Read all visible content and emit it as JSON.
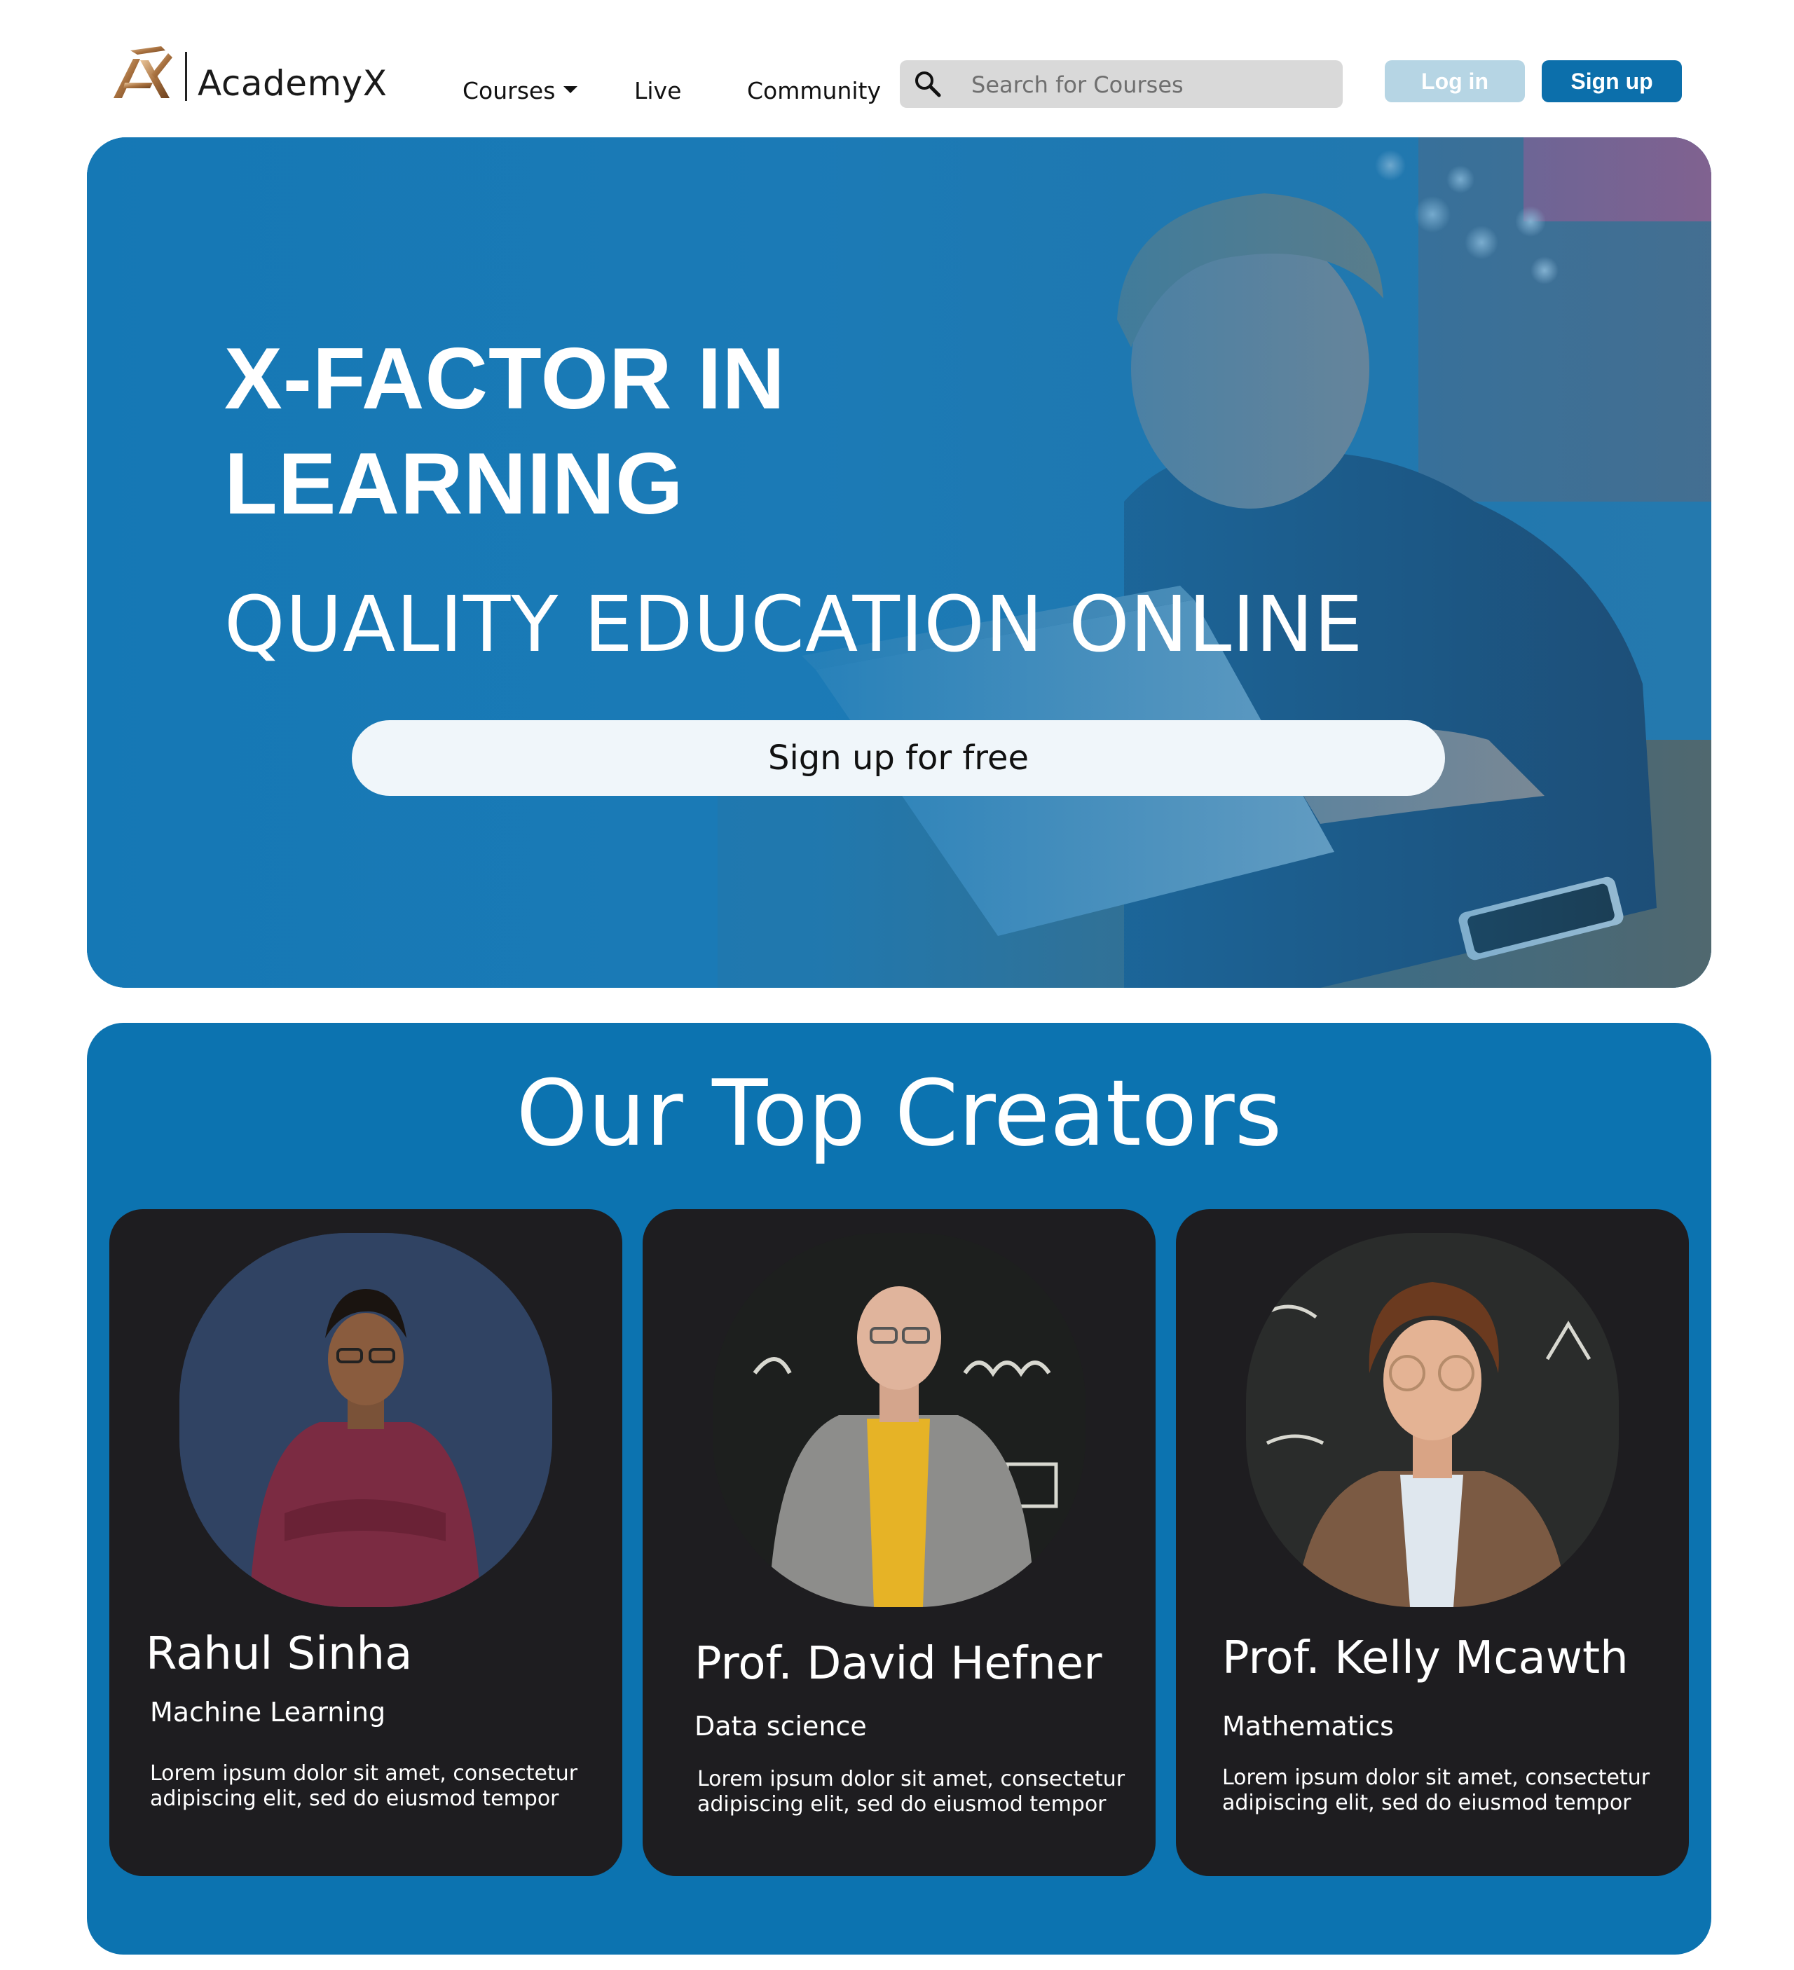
{
  "brand": {
    "name": "AcademyX"
  },
  "nav": {
    "courses_label": "Courses",
    "live_label": "Live",
    "community_label": "Community",
    "search_placeholder": "Search for Courses",
    "login_label": "Log in",
    "signup_label": "Sign up"
  },
  "hero": {
    "title_line1": "X-FACTOR IN",
    "title_line2": "LEARNING",
    "subtitle": "QUALITY EDUCATION ONLINE",
    "cta_label": "Sign up for free"
  },
  "creators": {
    "title": "Our Top Creators",
    "cards": [
      {
        "name": "Rahul Sinha",
        "field": "Machine Learning",
        "desc_line1": "Lorem ipsum dolor sit amet, consectetur",
        "desc_line2": "adipiscing elit, sed do eiusmod tempor"
      },
      {
        "name": "Prof. David Hefner",
        "field": "Data science",
        "desc_line1": "Lorem ipsum dolor sit amet, consectetur",
        "desc_line2": "adipiscing elit, sed do eiusmod tempor"
      },
      {
        "name": "Prof. Kelly Mcawth",
        "field": "Mathematics",
        "desc_line1": "Lorem ipsum dolor sit amet, consectetur",
        "desc_line2": "adipiscing elit, sed do eiusmod tempor"
      }
    ]
  },
  "colors": {
    "primary_blue": "#0c6fab",
    "hero_blue": "#1578b5",
    "login_button": "#b6d5e4",
    "card_background": "#1e1d20",
    "logo_gold": "#9a6a3c"
  },
  "icons": {
    "logo": "academyx-logo-icon",
    "search": "search-icon",
    "courses_dropdown": "caret-down-icon"
  }
}
